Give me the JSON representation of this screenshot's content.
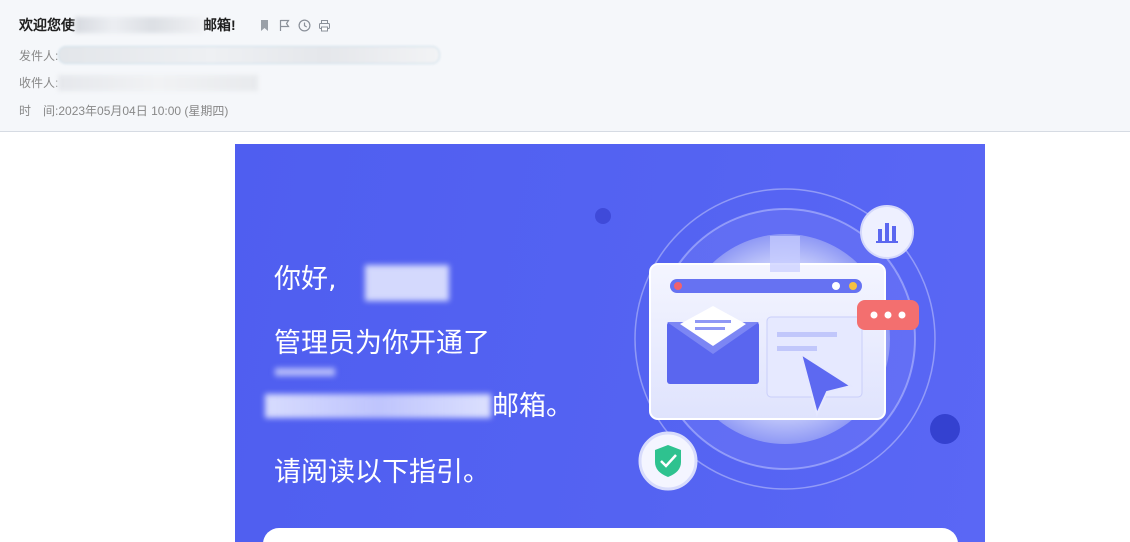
{
  "header": {
    "subject_prefix": "欢迎您使",
    "subject_suffix": "邮箱!",
    "sender_label": "发件人:",
    "recipient_label": "收件人:",
    "time_label": "时　间:",
    "time_value": "2023年05月04日 10:00 (星期四)",
    "icons": [
      "bookmark-icon",
      "flag-icon",
      "clock-icon",
      "print-icon"
    ]
  },
  "banner": {
    "greeting": "你好,",
    "line1": "管理员为你开通了",
    "line2_suffix": "邮箱。",
    "line3": "请阅读以下指引。",
    "colors": {
      "background": "#5462f2",
      "accent": "#ffffff"
    }
  }
}
